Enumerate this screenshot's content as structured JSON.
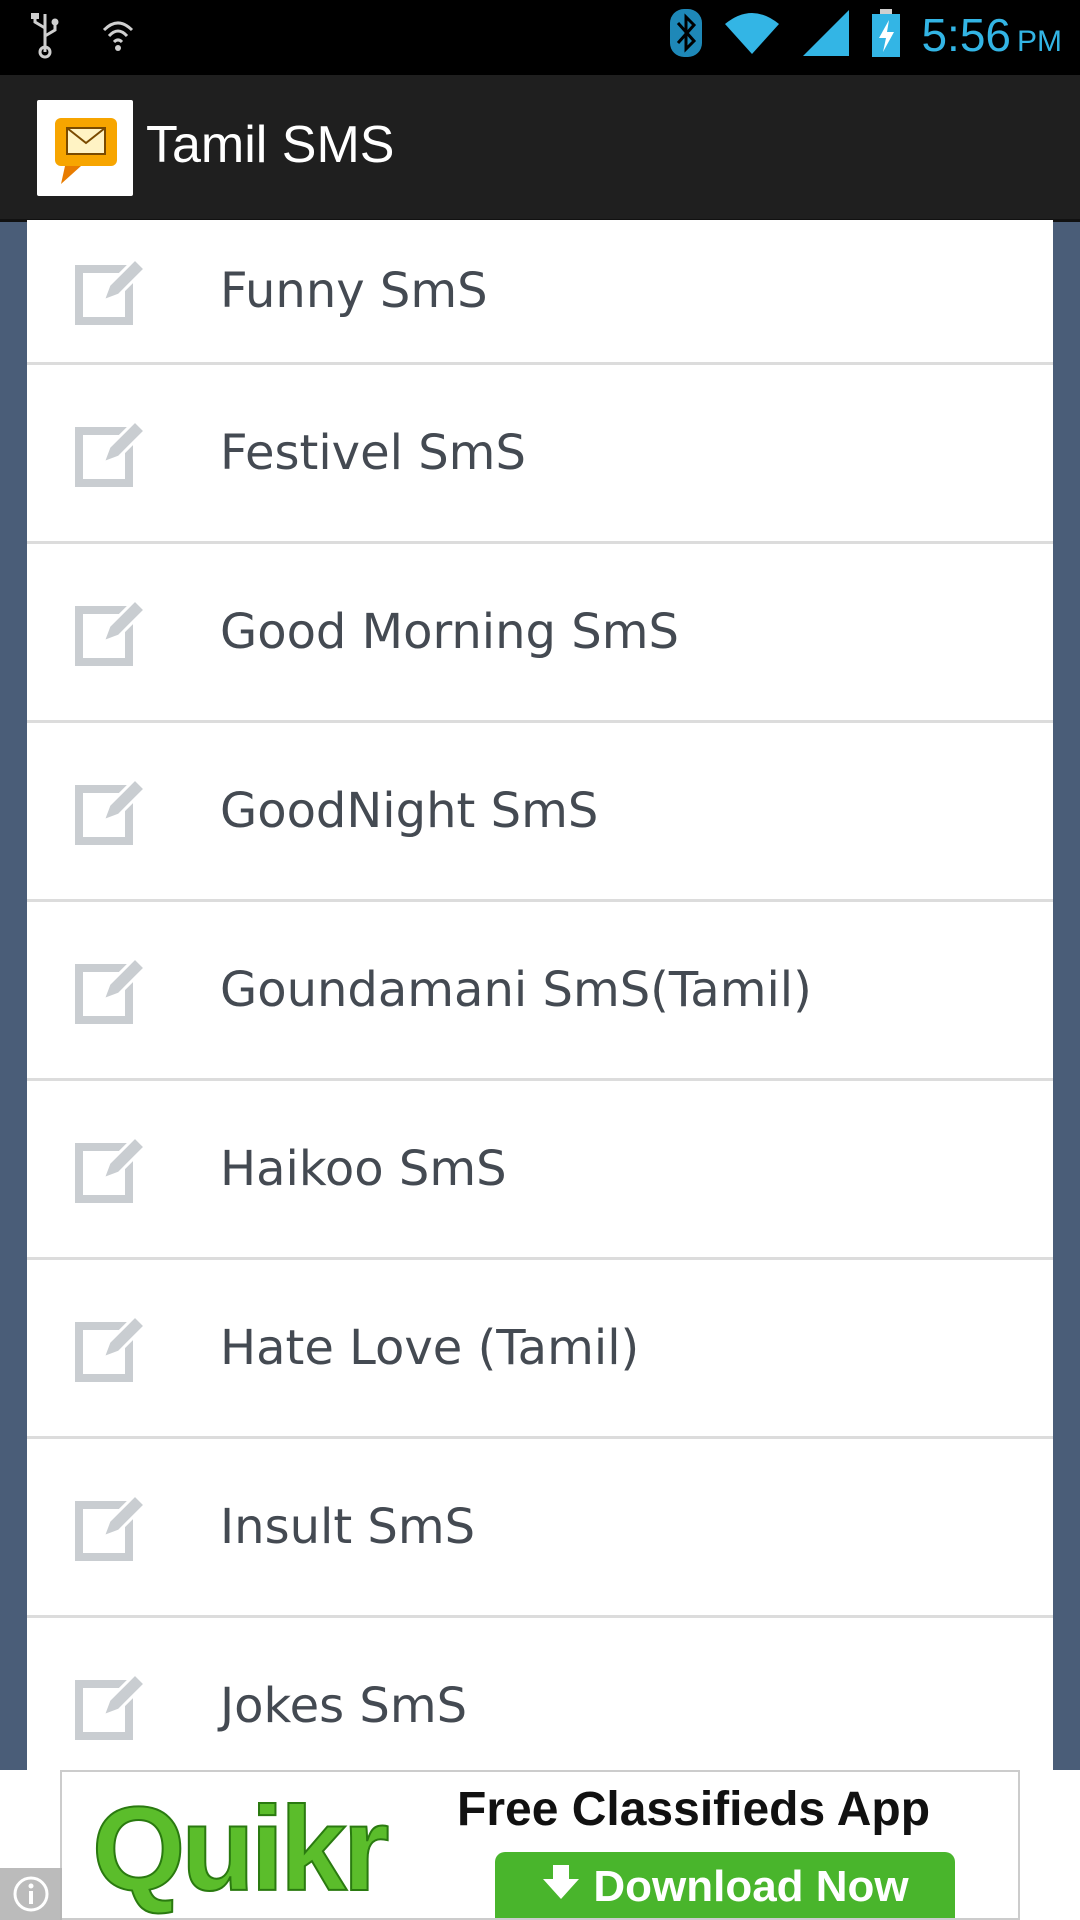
{
  "status_bar": {
    "time": "5:56",
    "ampm": "PM",
    "icons": [
      "usb-icon",
      "wifi-hotspot-icon",
      "bluetooth-icon",
      "wifi-icon",
      "signal-icon",
      "battery-charging-icon"
    ]
  },
  "action_bar": {
    "title": "Tamil SMS",
    "icon": "app-message-icon"
  },
  "list": {
    "items": [
      {
        "label": "Funny SmS",
        "icon": "edit-icon"
      },
      {
        "label": "Festivel SmS",
        "icon": "edit-icon"
      },
      {
        "label": "Good Morning SmS",
        "icon": "edit-icon"
      },
      {
        "label": "GoodNight SmS",
        "icon": "edit-icon"
      },
      {
        "label": "Goundamani SmS(Tamil)",
        "icon": "edit-icon"
      },
      {
        "label": "Haikoo SmS",
        "icon": "edit-icon"
      },
      {
        "label": "Hate Love (Tamil)",
        "icon": "edit-icon"
      },
      {
        "label": "Insult SmS",
        "icon": "edit-icon"
      },
      {
        "label": "Jokes SmS",
        "icon": "edit-icon"
      }
    ]
  },
  "ad": {
    "brand": "Quikr",
    "headline": "Free Classifieds App",
    "cta": "Download Now"
  },
  "colors": {
    "accent": "#33b5e5",
    "background": "#4a5d78",
    "ad_green": "#49b52c"
  }
}
